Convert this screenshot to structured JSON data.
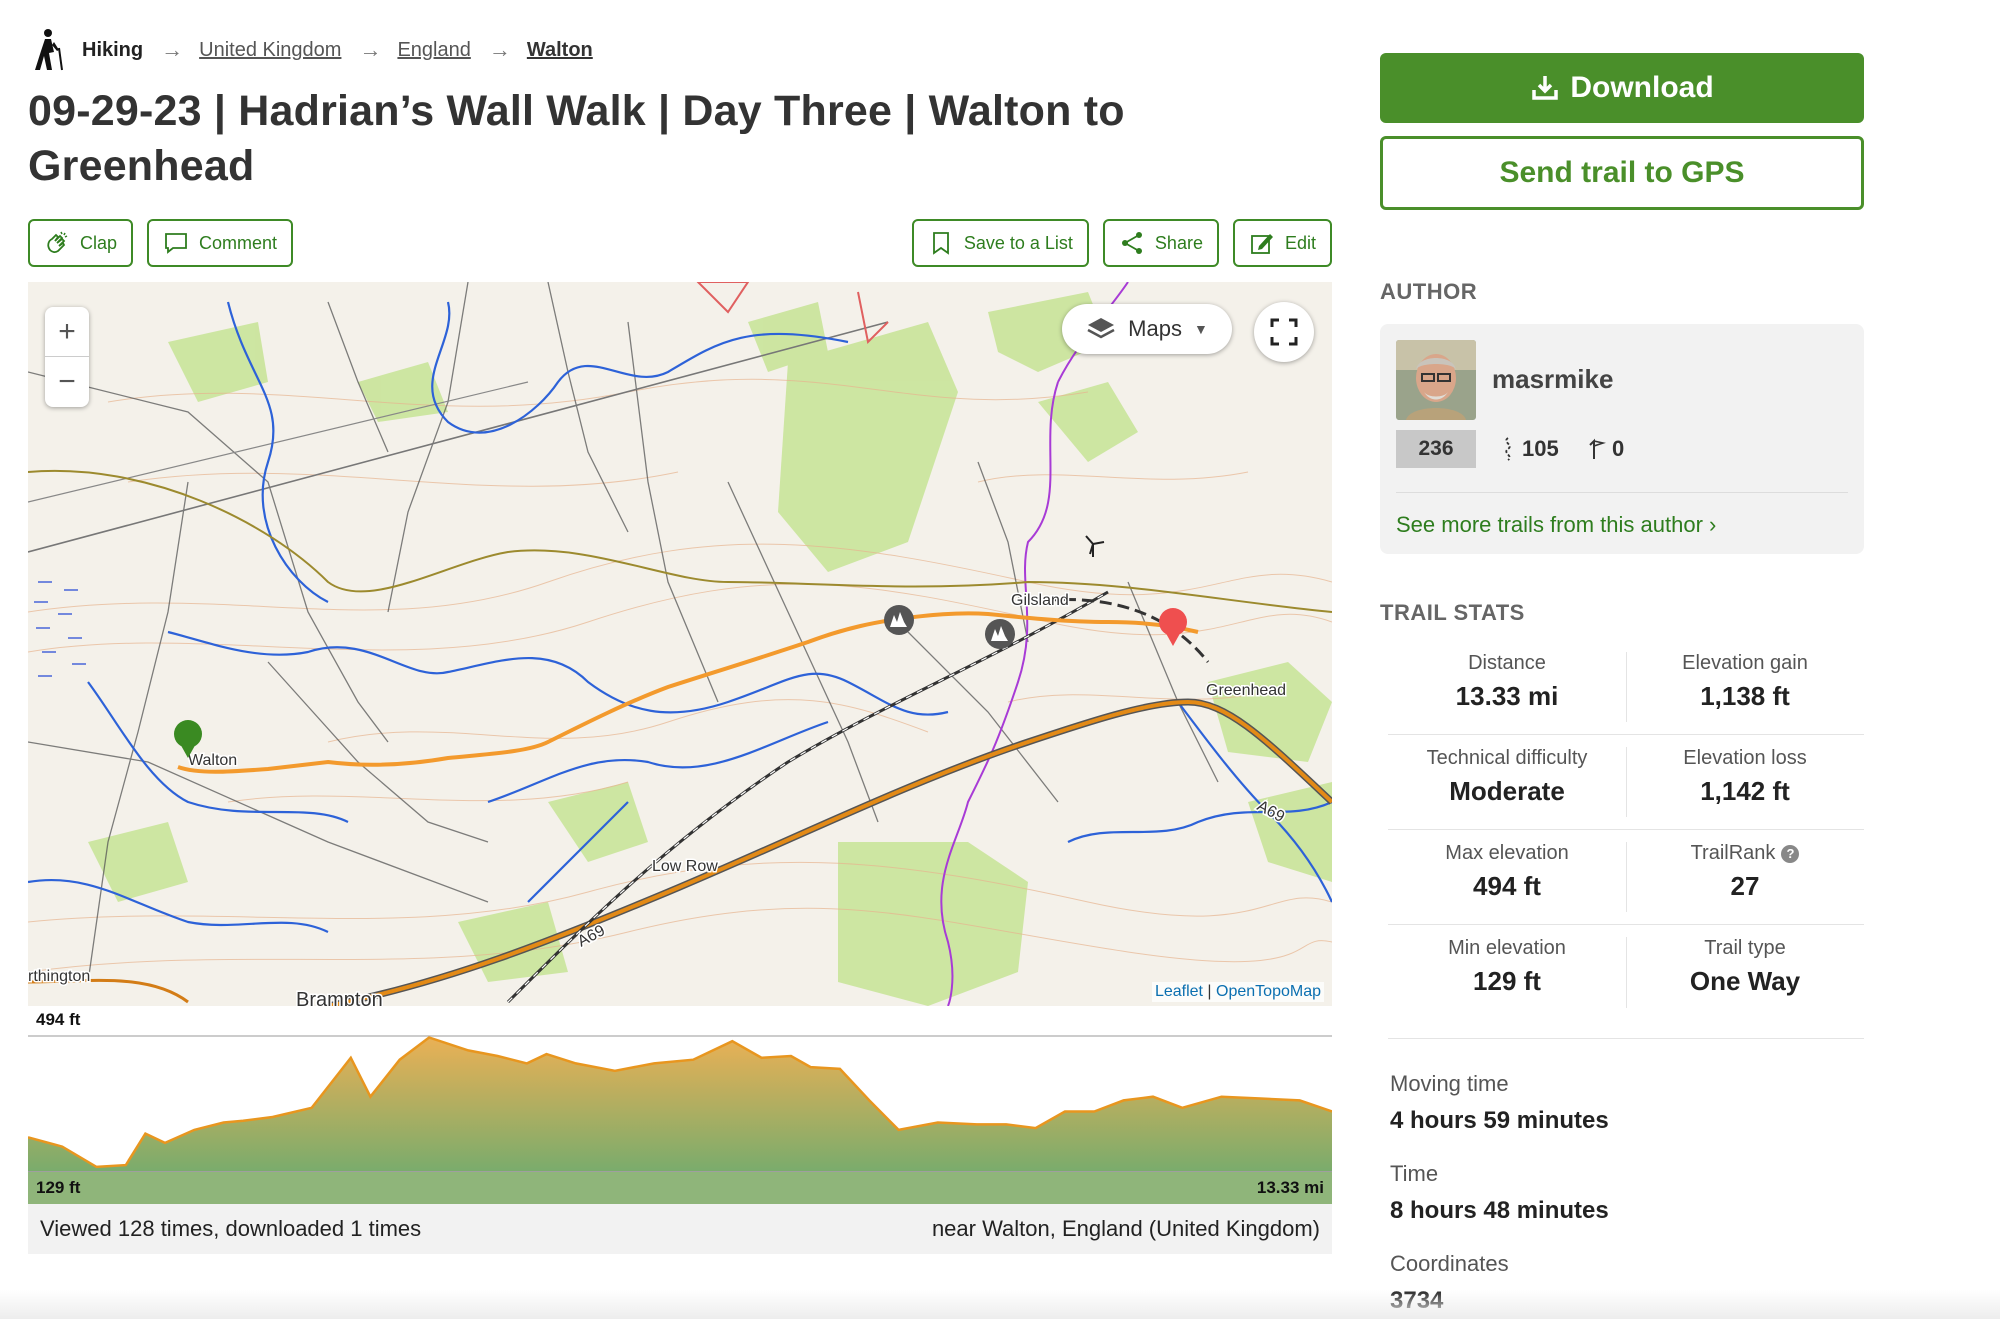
{
  "breadcrumb": {
    "items": [
      "Hiking",
      "United Kingdom",
      "England",
      "Walton"
    ]
  },
  "trail": {
    "title": "09-29-23 | Hadrian’s Wall Walk | Day Three | Walton to Greenhead"
  },
  "actions": {
    "clap": "Clap",
    "comment": "Comment",
    "save": "Save to a List",
    "share": "Share",
    "edit": "Edit"
  },
  "map": {
    "layers_label": "Maps",
    "attribution_leaflet": "Leaflet",
    "attribution_sep": " | ",
    "attribution_topo": "OpenTopoMap",
    "places": [
      "Walton",
      "Gilsland",
      "Greenhead",
      "Low Row",
      "A69",
      "rthington",
      "Brampton"
    ]
  },
  "profile": {
    "max_label": "494 ft",
    "min_label": "129 ft",
    "distance_label": "13.33 mi",
    "chart_data": {
      "type": "area",
      "xlabel": "",
      "ylabel": "",
      "x_range": [
        0,
        13.33
      ],
      "y_range": [
        129,
        494
      ],
      "x": [
        0,
        0.35,
        0.7,
        1.0,
        1.2,
        1.4,
        1.7,
        2.0,
        2.2,
        2.5,
        2.9,
        3.3,
        3.5,
        3.8,
        4.1,
        4.5,
        4.8,
        5.1,
        5.3,
        5.6,
        6.0,
        6.4,
        6.8,
        7.2,
        7.5,
        7.8,
        8.0,
        8.3,
        8.6,
        8.9,
        9.3,
        9.7,
        10.0,
        10.3,
        10.6,
        10.9,
        11.2,
        11.5,
        11.8,
        12.2,
        12.6,
        13.0,
        13.33
      ],
      "elevation": [
        220,
        195,
        140,
        145,
        230,
        205,
        240,
        260,
        265,
        275,
        300,
        435,
        330,
        430,
        490,
        455,
        440,
        420,
        445,
        420,
        400,
        420,
        430,
        480,
        435,
        440,
        410,
        405,
        320,
        240,
        260,
        255,
        255,
        245,
        290,
        290,
        320,
        330,
        300,
        330,
        325,
        320,
        290
      ]
    }
  },
  "footer": {
    "views": "Viewed 128 times, downloaded 1 times",
    "location": "near Walton, England (United Kingdom)"
  },
  "sidebar": {
    "download": "Download",
    "send_gps": "Send trail to GPS",
    "author_heading": "AUTHOR",
    "author": {
      "name": "masrmike",
      "rank": "236",
      "trails": "105",
      "flags": "0",
      "see_more": "See more trails from this author ›"
    },
    "stats_heading": "TRAIL STATS",
    "stats": [
      {
        "label": "Distance",
        "value": "13.33 mi"
      },
      {
        "label": "Elevation gain",
        "value": "1,138 ft"
      },
      {
        "label": "Technical difficulty",
        "value": "Moderate"
      },
      {
        "label": "Elevation loss",
        "value": "1,142 ft"
      },
      {
        "label": "Max elevation",
        "value": "494 ft"
      },
      {
        "label": "TrailRank",
        "value": "27"
      },
      {
        "label": "Min elevation",
        "value": "129 ft"
      },
      {
        "label": "Trail type",
        "value": "One Way"
      }
    ],
    "details": [
      {
        "label": "Moving time",
        "value": "4 hours 59 minutes"
      },
      {
        "label": "Time",
        "value": "8 hours 48 minutes"
      },
      {
        "label": "Coordinates",
        "value": "3734"
      }
    ]
  },
  "colors": {
    "brand_green": "#4a8f2a",
    "route_orange": "#f39a2d",
    "start_marker": "#3a8a22",
    "end_marker": "#ef4f4f"
  }
}
